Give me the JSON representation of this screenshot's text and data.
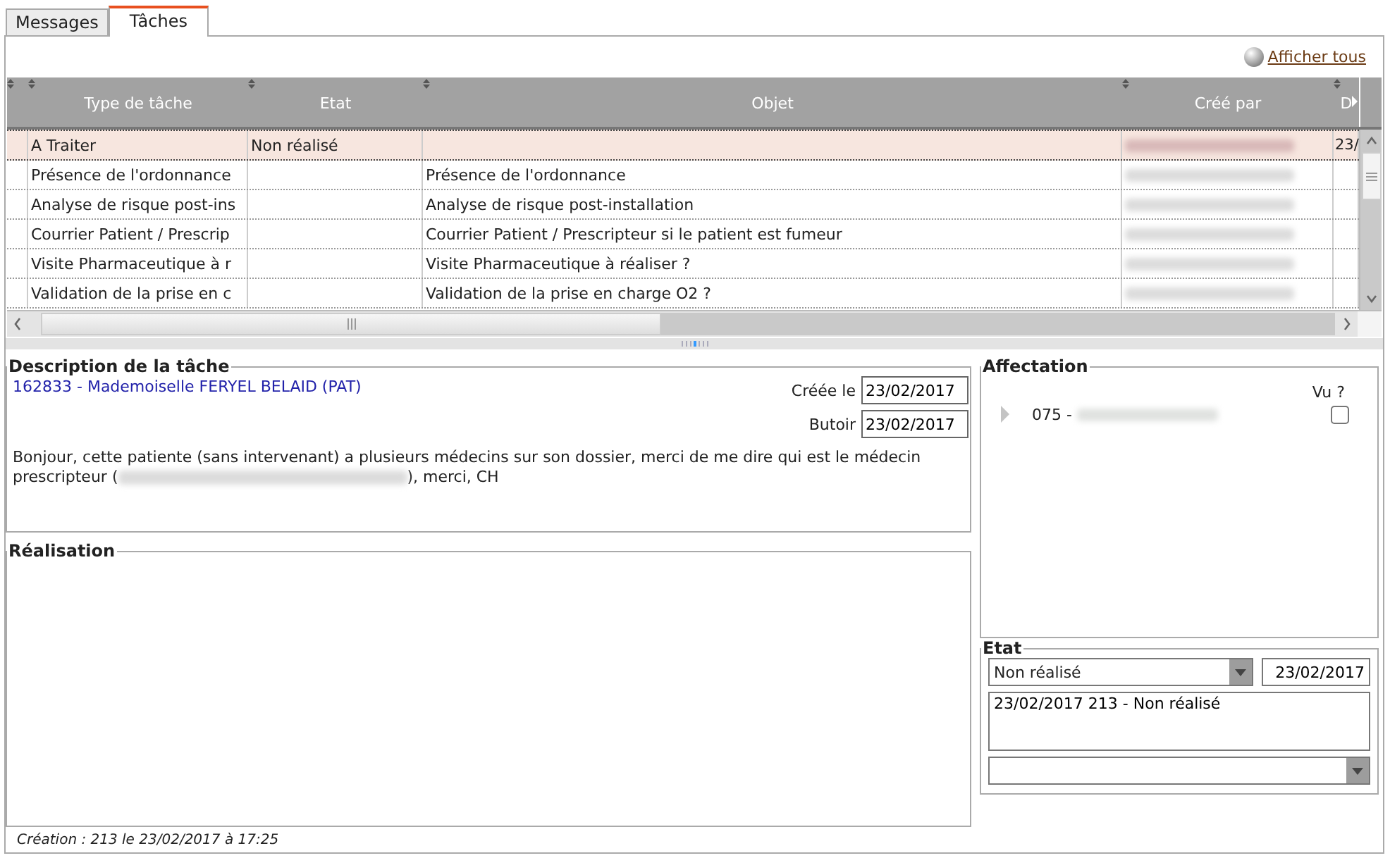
{
  "tabs": [
    {
      "label": "Messages",
      "selected": false
    },
    {
      "label": "Tâches",
      "selected": true
    }
  ],
  "toolbar": {
    "link": "Afficher tous"
  },
  "table": {
    "columns": [
      "",
      "Type  de tâche",
      "Etat",
      "Objet",
      "Créé par",
      "D"
    ],
    "rows": [
      {
        "cells": [
          "",
          "A Traiter",
          "Non réalisé",
          "",
          "",
          "23/"
        ],
        "selected": true,
        "created_by_blurred": true
      },
      {
        "cells": [
          "",
          "Présence de l'ordonnance",
          "",
          "Présence de l'ordonnance",
          "",
          ""
        ],
        "selected": false,
        "created_by_blurred": true
      },
      {
        "cells": [
          "",
          "Analyse de risque post-ins",
          "",
          "Analyse de risque post-installation",
          "",
          ""
        ],
        "selected": false,
        "created_by_blurred": true
      },
      {
        "cells": [
          "",
          "Courrier Patient / Prescrip",
          "",
          "Courrier Patient / Prescripteur si le patient est fumeur",
          "",
          ""
        ],
        "selected": false,
        "created_by_blurred": true
      },
      {
        "cells": [
          "",
          "Visite Pharmaceutique à r",
          "",
          "Visite Pharmaceutique à réaliser ?",
          "",
          ""
        ],
        "selected": false,
        "created_by_blurred": true
      },
      {
        "cells": [
          "",
          "Validation de la prise en c",
          "",
          "Validation de la prise en charge O2 ?",
          "",
          ""
        ],
        "selected": false,
        "created_by_blurred": true
      }
    ]
  },
  "description": {
    "title": "Description de la tâche",
    "patient": "162833 - Mademoiselle FERYEL BELAID (PAT)",
    "fields": [
      {
        "label": "Créée le",
        "value": "23/02/2017"
      },
      {
        "label": "Butoir",
        "value": "23/02/2017"
      }
    ],
    "text_before": "Bonjour, cette patiente (sans intervenant) a plusieurs médecins sur son dossier, merci de me dire qui est le médecin prescripteur (",
    "redacted": true,
    "text_after": "), merci, CH"
  },
  "realisation": {
    "title": "Réalisation"
  },
  "footer": "Création : 213 le 23/02/2017 à 17:25",
  "affectation": {
    "title": "Affectation",
    "seen_header": "Vu ?",
    "items": [
      {
        "label": "075 - ",
        "redacted": true,
        "expanded": false,
        "checked": false
      }
    ]
  },
  "etat": {
    "title": "Etat",
    "status": "Non réalisé",
    "date": "23/02/2017",
    "history": "23/02/2017 213 - Non réalisé"
  }
}
